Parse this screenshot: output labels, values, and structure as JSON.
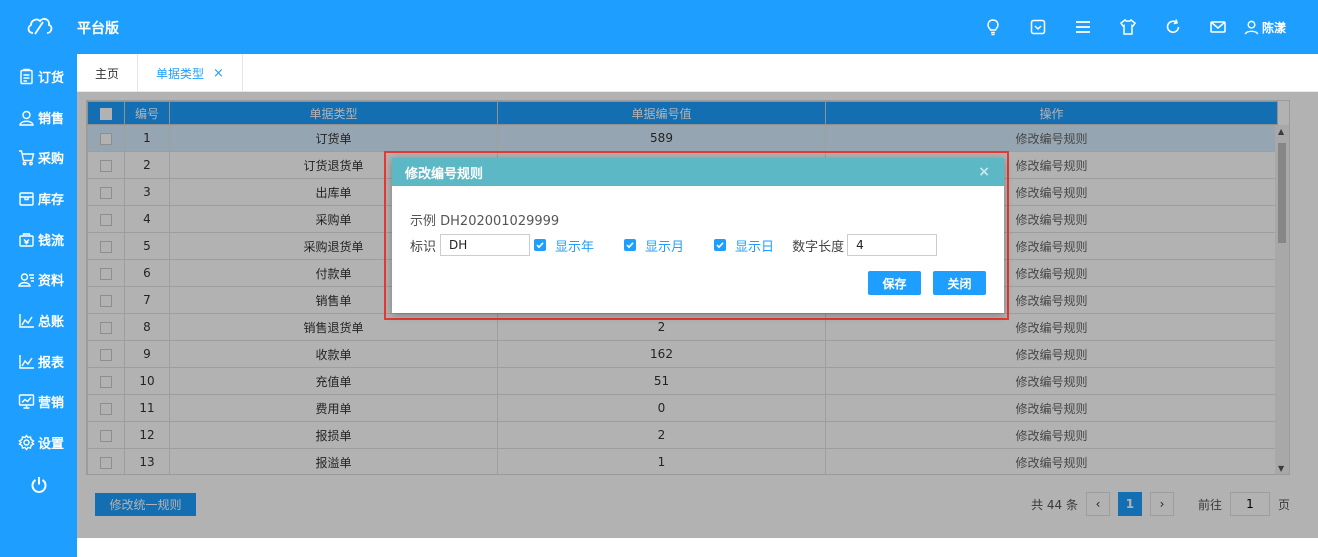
{
  "app": {
    "brand": "平台版",
    "user": "陈漾"
  },
  "topbar": {
    "icons": [
      "bulb-icon",
      "dropdown-box-icon",
      "menu-icon",
      "shirt-icon",
      "refresh-icon",
      "mail-icon"
    ]
  },
  "sidebar": {
    "items": [
      {
        "label": "订货",
        "icon": "clipboard-icon"
      },
      {
        "label": "销售",
        "icon": "user-icon"
      },
      {
        "label": "采购",
        "icon": "cart-icon"
      },
      {
        "label": "库存",
        "icon": "box-icon"
      },
      {
        "label": "钱流",
        "icon": "money-bag-icon"
      },
      {
        "label": "资料",
        "icon": "contacts-icon"
      },
      {
        "label": "总账",
        "icon": "area-chart-icon"
      },
      {
        "label": "报表",
        "icon": "line-chart-icon"
      },
      {
        "label": "营销",
        "icon": "monitor-chart-icon"
      },
      {
        "label": "设置",
        "icon": "gear-icon"
      }
    ]
  },
  "tabs": [
    {
      "label": "主页",
      "active": false
    },
    {
      "label": "单据类型",
      "active": true,
      "close": "×"
    }
  ],
  "table": {
    "columns": [
      "编号",
      "单据类型",
      "单据编号值",
      "操作"
    ],
    "rows": [
      {
        "id": "1",
        "type": "订货单",
        "value": "589",
        "op": "修改编号规则"
      },
      {
        "id": "2",
        "type": "订货退货单",
        "value": "",
        "op": "修改编号规则"
      },
      {
        "id": "3",
        "type": "出库单",
        "value": "",
        "op": "修改编号规则"
      },
      {
        "id": "4",
        "type": "采购单",
        "value": "",
        "op": "修改编号规则"
      },
      {
        "id": "5",
        "type": "采购退货单",
        "value": "",
        "op": "修改编号规则"
      },
      {
        "id": "6",
        "type": "付款单",
        "value": "",
        "op": "修改编号规则"
      },
      {
        "id": "7",
        "type": "销售单",
        "value": "",
        "op": "修改编号规则"
      },
      {
        "id": "8",
        "type": "销售退货单",
        "value": "2",
        "op": "修改编号规则"
      },
      {
        "id": "9",
        "type": "收款单",
        "value": "162",
        "op": "修改编号规则"
      },
      {
        "id": "10",
        "type": "充值单",
        "value": "51",
        "op": "修改编号规则"
      },
      {
        "id": "11",
        "type": "费用单",
        "value": "0",
        "op": "修改编号规则"
      },
      {
        "id": "12",
        "type": "报损单",
        "value": "2",
        "op": "修改编号规则"
      },
      {
        "id": "13",
        "type": "报溢单",
        "value": "1",
        "op": "修改编号规则"
      }
    ]
  },
  "footer": {
    "bulk_button": "修改统一规则",
    "total": "共 44 条",
    "prev": "‹",
    "current_page": "1",
    "next": "›",
    "goto_label": "前往",
    "goto_value": "1",
    "page_suffix": "页"
  },
  "dialog": {
    "title": "修改编号规则",
    "close": "×",
    "example": "示例 DH202001029999",
    "prefix_label": "标识",
    "prefix_value": "DH",
    "show_year": "显示年",
    "show_month": "显示月",
    "show_day": "显示日",
    "length_label": "数字长度",
    "length_value": "4",
    "save": "保存",
    "close_button": "关闭"
  },
  "colors": {
    "primary": "#1e9fff",
    "dialog_header": "#5bb8c4",
    "highlight": "#e53935"
  }
}
